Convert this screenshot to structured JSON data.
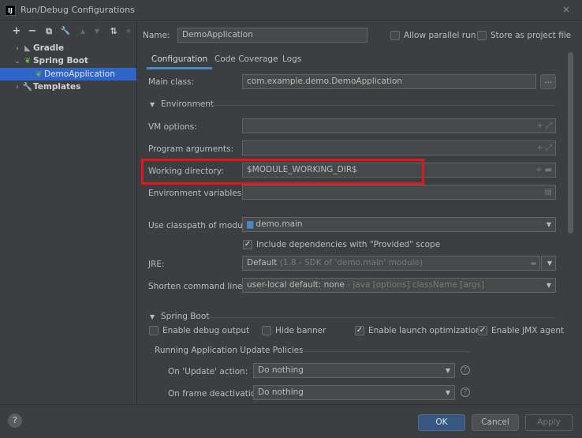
{
  "window": {
    "title": "Run/Debug Configurations",
    "app_icon": "IJ",
    "close": "×"
  },
  "toolbar": {
    "add": "+",
    "remove": "−",
    "copy": "⧉",
    "edit": "🔧",
    "up": "▲",
    "down": "▼",
    "sort": "⇅",
    "more": "»"
  },
  "tree": {
    "gradle": "Gradle",
    "spring_boot": "Spring Boot",
    "demo_app": "DemoApplication",
    "templates": "Templates"
  },
  "header": {
    "name_label": "Name:",
    "name_value": "DemoApplication",
    "allow_parallel": "Allow parallel run",
    "store_project": "Store as project file"
  },
  "tabs": [
    "Configuration",
    "Code Coverage",
    "Logs"
  ],
  "form": {
    "main_class_label": "Main class:",
    "main_class_value": "com.example.demo.DemoApplication",
    "main_class_btn": "...",
    "environment_section": "Environment",
    "vm_options_label": "VM options:",
    "program_args_label": "Program arguments:",
    "working_dir_label": "Working directory:",
    "working_dir_value": "$MODULE_WORKING_DIR$",
    "env_vars_label": "Environment variables:",
    "classpath_label": "Use classpath of module:",
    "classpath_value": "demo.main",
    "include_deps": "Include dependencies with \"Provided\" scope",
    "jre_label": "JRE:",
    "jre_value": "Default",
    "jre_hint": "(1.8 - SDK of 'demo.main' module)",
    "shorten_label": "Shorten command line:",
    "shorten_value": "user-local default: none",
    "shorten_hint": "- java [options] className [args]"
  },
  "spring": {
    "section": "Spring Boot",
    "debug_output": "Enable debug output",
    "hide_banner": "Hide banner",
    "launch_opt": "Enable launch optimization",
    "jmx_agent": "Enable JMX agent",
    "policies_section": "Running Application Update Policies",
    "on_update_label": "On 'Update' action:",
    "on_update_value": "Do nothing",
    "on_frame_label": "On frame deactivation:",
    "on_frame_value": "Do nothing"
  },
  "buttons": {
    "help": "?",
    "ok": "OK",
    "cancel": "Cancel",
    "apply": "Apply"
  },
  "colors": {
    "accent": "#365880",
    "selection": "#2f65ca",
    "highlight": "#e8141b",
    "background": "#3c3f41"
  }
}
